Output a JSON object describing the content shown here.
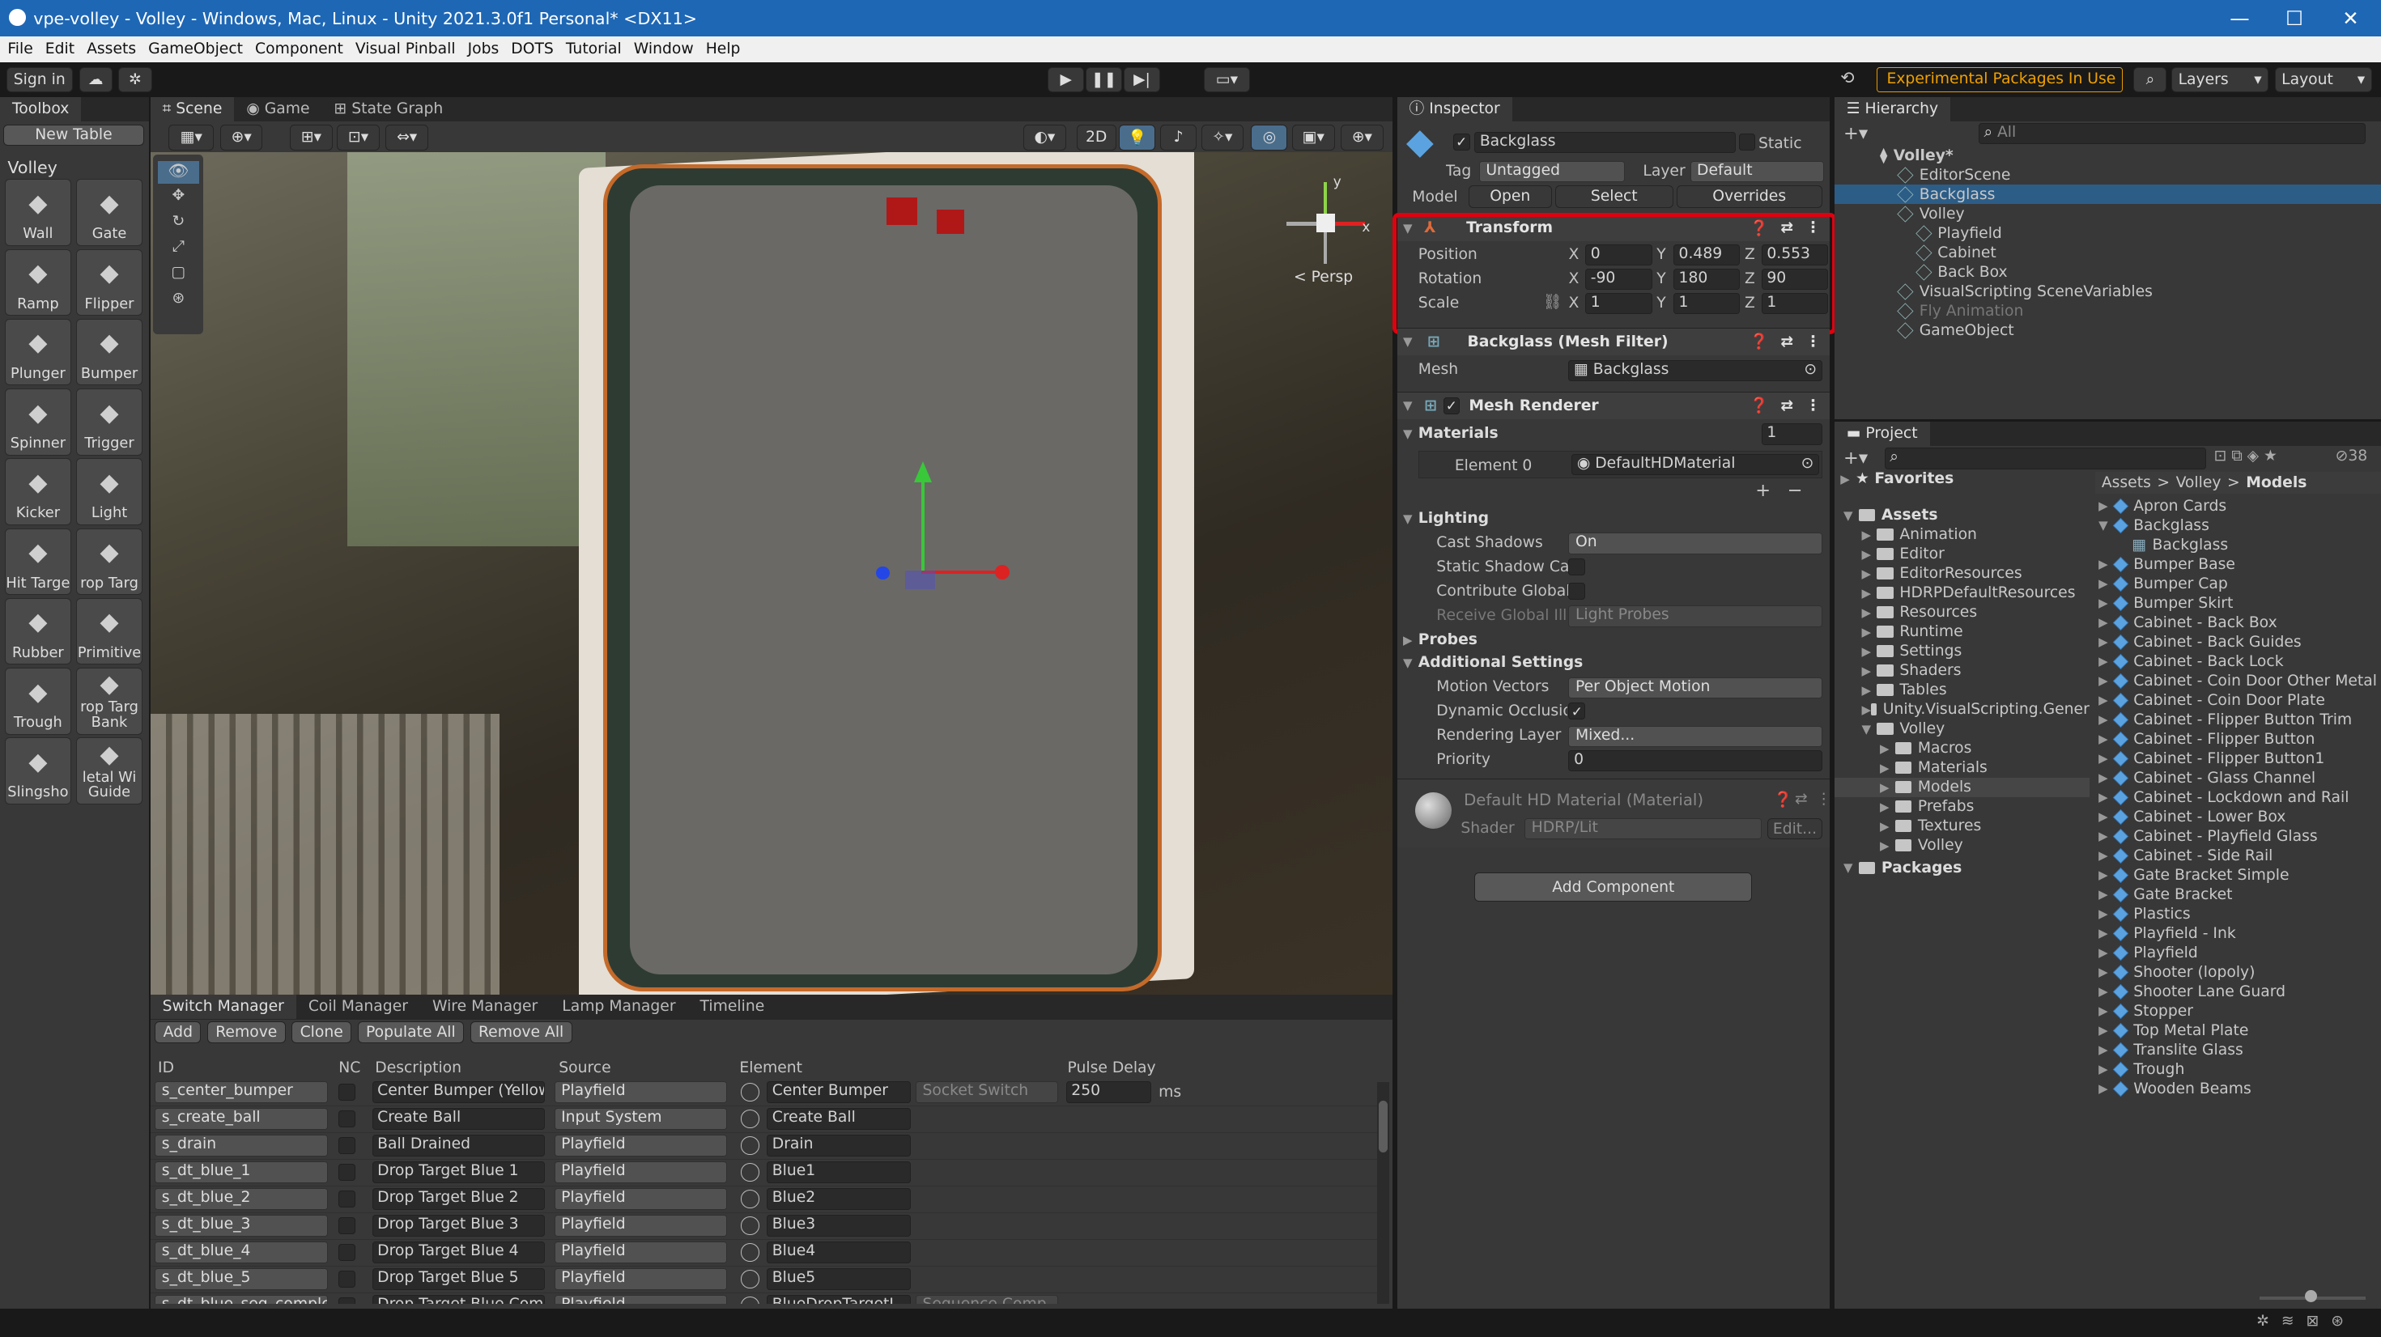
{
  "window": {
    "title": "vpe-volley - Volley - Windows, Mac, Linux - Unity 2021.3.0f1 Personal* <DX11>",
    "minimize": "—",
    "maximize": "☐",
    "close": "✕"
  },
  "menu": [
    "File",
    "Edit",
    "Assets",
    "GameObject",
    "Component",
    "Visual Pinball",
    "Jobs",
    "DOTS",
    "Tutorial",
    "Window",
    "Help"
  ],
  "toolbar": {
    "signin": "Sign in",
    "experimental": "Experimental Packages In Use ▾",
    "layers": "Layers",
    "layout": "Layout"
  },
  "toolbox": {
    "tab": "Toolbox",
    "new_table": "New Table",
    "section": "Volley",
    "tools": [
      {
        "label": "Wall",
        "icon": "wall-icon"
      },
      {
        "label": "Gate",
        "icon": "gate-icon"
      },
      {
        "label": "Ramp",
        "icon": "ramp-icon"
      },
      {
        "label": "Flipper",
        "icon": "flipper-icon"
      },
      {
        "label": "Plunger",
        "icon": "plunger-icon"
      },
      {
        "label": "Bumper",
        "icon": "bumper-icon"
      },
      {
        "label": "Spinner",
        "icon": "spinner-icon"
      },
      {
        "label": "Trigger",
        "icon": "trigger-icon"
      },
      {
        "label": "Kicker",
        "icon": "kicker-icon"
      },
      {
        "label": "Light",
        "icon": "light-icon"
      },
      {
        "label": "Hit Targe",
        "icon": "hit-target-icon"
      },
      {
        "label": "rop Targ",
        "icon": "drop-target-icon"
      },
      {
        "label": "Rubber",
        "icon": "rubber-icon"
      },
      {
        "label": "Primitive",
        "icon": "primitive-icon"
      },
      {
        "label": "Trough",
        "icon": "trough-icon"
      },
      {
        "label": "rop Targ\nBank",
        "icon": "drop-target-bank-icon"
      },
      {
        "label": "Slingsho",
        "icon": "slingshot-icon"
      },
      {
        "label": "letal Wi\nGuide",
        "icon": "metal-wire-guide-icon"
      }
    ]
  },
  "scene": {
    "tabs": [
      "Scene",
      "Game",
      "State Graph"
    ],
    "mode2d": "2D",
    "persp": "< Persp",
    "gizmo": {
      "x": "x",
      "y": "y"
    }
  },
  "bottom": {
    "tabs": [
      "Switch Manager",
      "Coil Manager",
      "Wire Manager",
      "Lamp Manager",
      "Timeline"
    ],
    "buttons": [
      "Add",
      "Remove",
      "Clone",
      "Populate All",
      "Remove All"
    ],
    "columns": [
      "ID",
      "NC",
      "Description",
      "Source",
      "Element",
      "Pulse Delay"
    ],
    "rows": [
      {
        "id": "s_center_bumper",
        "desc": "Center Bumper (Yellow)",
        "source": "Playfield",
        "element": "Center Bumper",
        "extra": "Socket Switch",
        "pulse": "250",
        "unit": "ms"
      },
      {
        "id": "s_create_ball",
        "desc": "Create Ball",
        "source": "Input System",
        "element": "Create Ball",
        "extra": "",
        "pulse": "",
        "unit": ""
      },
      {
        "id": "s_drain",
        "desc": "Ball Drained",
        "source": "Playfield",
        "element": "Drain",
        "extra": "",
        "pulse": "",
        "unit": ""
      },
      {
        "id": "s_dt_blue_1",
        "desc": "Drop Target Blue 1",
        "source": "Playfield",
        "element": "Blue1",
        "extra": "",
        "pulse": "",
        "unit": ""
      },
      {
        "id": "s_dt_blue_2",
        "desc": "Drop Target Blue 2",
        "source": "Playfield",
        "element": "Blue2",
        "extra": "",
        "pulse": "",
        "unit": ""
      },
      {
        "id": "s_dt_blue_3",
        "desc": "Drop Target Blue 3",
        "source": "Playfield",
        "element": "Blue3",
        "extra": "",
        "pulse": "",
        "unit": ""
      },
      {
        "id": "s_dt_blue_4",
        "desc": "Drop Target Blue 4",
        "source": "Playfield",
        "element": "Blue4",
        "extra": "",
        "pulse": "",
        "unit": ""
      },
      {
        "id": "s_dt_blue_5",
        "desc": "Drop Target Blue 5",
        "source": "Playfield",
        "element": "Blue5",
        "extra": "",
        "pulse": "",
        "unit": ""
      },
      {
        "id": "s_dt_blue_seq_comple",
        "desc": "Drop Target Blue Compl",
        "source": "Playfield",
        "element": "BlueDropTargetI",
        "extra": "Sequence Comp",
        "pulse": "",
        "unit": ""
      }
    ]
  },
  "inspector": {
    "tab": "Inspector",
    "object": "Backglass",
    "static": "Static",
    "tag_label": "Tag",
    "tag": "Untagged",
    "layer_label": "Layer",
    "layer": "Default",
    "model_label": "Model",
    "open": "Open",
    "select": "Select",
    "overrides": "Overrides",
    "transform": {
      "title": "Transform",
      "position": {
        "label": "Position",
        "x": "0",
        "y": "0.489",
        "z": "0.553"
      },
      "rotation": {
        "label": "Rotation",
        "x": "-90",
        "y": "180",
        "z": "90"
      },
      "scale": {
        "label": "Scale",
        "x": "1",
        "y": "1",
        "z": "1"
      }
    },
    "mesh_filter": {
      "title": "Backglass (Mesh Filter)",
      "mesh_label": "Mesh",
      "mesh": "Backglass"
    },
    "mesh_renderer": {
      "title": "Mesh Renderer",
      "materials": "Materials",
      "count": "1",
      "element0": "Element 0",
      "material": "DefaultHDMaterial",
      "lighting": "Lighting",
      "cast_shadows": "Cast Shadows",
      "cast_val": "On",
      "static_shadow": "Static Shadow Cas",
      "contribute": "Contribute Global",
      "receive": "Receive Global Illu",
      "receive_val": "Light Probes",
      "probes": "Probes",
      "additional": "Additional Settings",
      "motion": "Motion Vectors",
      "motion_val": "Per Object Motion",
      "dynamic": "Dynamic Occlusio",
      "rendering": "Rendering Layer M",
      "rendering_val": "Mixed...",
      "priority": "Priority",
      "priority_val": "0"
    },
    "material": {
      "title": "Default HD Material (Material)",
      "shader_label": "Shader",
      "shader": "HDRP/Lit",
      "edit": "Edit..."
    },
    "add_component": "Add Component"
  },
  "hierarchy": {
    "tab": "Hierarchy",
    "search": "All",
    "items": [
      {
        "name": "Volley*",
        "indent": 0,
        "kind": "scene"
      },
      {
        "name": "EditorScene",
        "indent": 1,
        "kind": "go"
      },
      {
        "name": "Backglass",
        "indent": 1,
        "kind": "go",
        "selected": true
      },
      {
        "name": "Volley",
        "indent": 1,
        "kind": "go"
      },
      {
        "name": "Playfield",
        "indent": 2,
        "kind": "go"
      },
      {
        "name": "Cabinet",
        "indent": 2,
        "kind": "go"
      },
      {
        "name": "Back Box",
        "indent": 2,
        "kind": "go"
      },
      {
        "name": "VisualScripting SceneVariables",
        "indent": 1,
        "kind": "go"
      },
      {
        "name": "Fly Animation",
        "indent": 1,
        "kind": "go",
        "dim": true
      },
      {
        "name": "GameObject",
        "indent": 1,
        "kind": "go"
      }
    ]
  },
  "project": {
    "tab": "Project",
    "count": "38",
    "favorites": "Favorites",
    "breadcrumb": [
      "Assets",
      "Volley",
      "Models"
    ],
    "tree": [
      {
        "name": "Assets",
        "indent": 0,
        "bold": true
      },
      {
        "name": "Animation",
        "indent": 1
      },
      {
        "name": "Editor",
        "indent": 1
      },
      {
        "name": "EditorResources",
        "indent": 1
      },
      {
        "name": "HDRPDefaultResources",
        "indent": 1
      },
      {
        "name": "Resources",
        "indent": 1
      },
      {
        "name": "Runtime",
        "indent": 1
      },
      {
        "name": "Settings",
        "indent": 1
      },
      {
        "name": "Shaders",
        "indent": 1
      },
      {
        "name": "Tables",
        "indent": 1
      },
      {
        "name": "Unity.VisualScripting.Gener",
        "indent": 1
      },
      {
        "name": "Volley",
        "indent": 1
      },
      {
        "name": "Macros",
        "indent": 2
      },
      {
        "name": "Materials",
        "indent": 2
      },
      {
        "name": "Models",
        "indent": 2,
        "selected": true
      },
      {
        "name": "Prefabs",
        "indent": 2
      },
      {
        "name": "Textures",
        "indent": 2
      },
      {
        "name": "Volley",
        "indent": 2
      },
      {
        "name": "Packages",
        "indent": 0,
        "bold": true
      }
    ],
    "assets": [
      "Apron Cards",
      "Backglass",
      "Backglass",
      "Bumper Base",
      "Bumper Cap",
      "Bumper Skirt",
      "Cabinet - Back Box",
      "Cabinet - Back Guides",
      "Cabinet - Back Lock",
      "Cabinet - Coin Door Other Metal",
      "Cabinet - Coin Door Plate",
      "Cabinet - Flipper Button Trim",
      "Cabinet - Flipper Button",
      "Cabinet - Flipper Button1",
      "Cabinet - Glass Channel",
      "Cabinet - Lockdown and Rail",
      "Cabinet - Lower Box",
      "Cabinet - Playfield Glass",
      "Cabinet - Side Rail",
      "Gate Bracket Simple",
      "Gate Bracket",
      "Plastics",
      "Playfield - Ink",
      "Playfield",
      "Shooter (lopoly)",
      "Shooter Lane Guard",
      "Stopper",
      "Top Metal Plate",
      "Translite Glass",
      "Trough",
      "Wooden Beams"
    ]
  },
  "colors": {
    "accent": "#1e67b5",
    "highlight": "#e0000e",
    "selection": "#2c5d87"
  }
}
